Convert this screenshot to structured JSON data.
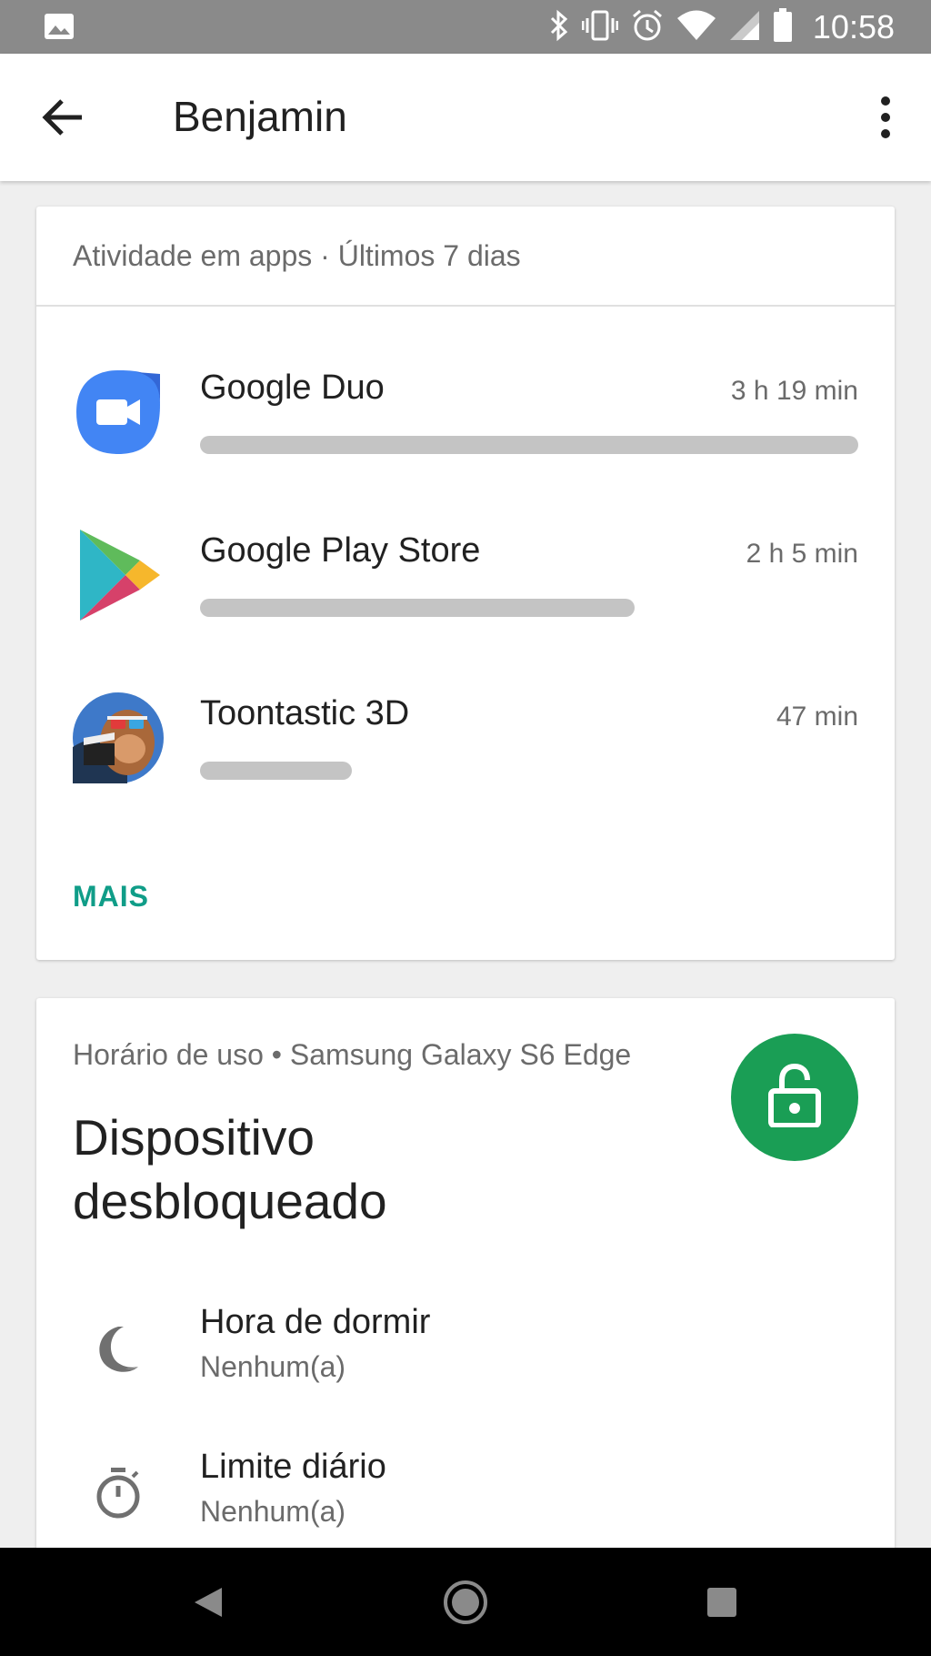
{
  "status_bar": {
    "time": "10:58",
    "icons": [
      "image-icon",
      "bluetooth-icon",
      "vibrate-icon",
      "alarm-icon",
      "wifi-icon",
      "signal-icon",
      "battery-icon"
    ]
  },
  "app_bar": {
    "title": "Benjamin",
    "icons": [
      "back-arrow-icon",
      "more-vert-icon"
    ]
  },
  "activity_card": {
    "header": "Atividade em apps · Últimos 7 dias",
    "apps": [
      {
        "name": "Google Duo",
        "time": "3 h 19 min",
        "usage_fraction": 1.0,
        "icon": "google-duo-icon",
        "color": "#4285f4"
      },
      {
        "name": "Google Play Store",
        "time": "2 h 5 min",
        "usage_fraction": 0.66,
        "icon": "play-store-icon"
      },
      {
        "name": "Toontastic 3D",
        "time": "47 min",
        "usage_fraction": 0.23,
        "icon": "toontastic-icon"
      }
    ],
    "more_label": "MAIS"
  },
  "device_card": {
    "subtitle": "Horário de uso • Samsung Galaxy S6 Edge",
    "heading": "Dispositivo desbloqueado",
    "lock_icon": "unlocked-lock-icon",
    "lock_color": "#1a9e55",
    "settings": [
      {
        "title": "Hora de dormir",
        "value": "Nenhum(a)",
        "icon": "moon-icon"
      },
      {
        "title": "Limite diário",
        "value": "Nenhum(a)",
        "icon": "timer-icon"
      }
    ]
  },
  "nav_bar": {
    "icons": [
      "back-triangle-icon",
      "home-circle-icon",
      "recents-square-icon"
    ]
  },
  "colors": {
    "accent": "#109d88",
    "bar_fill": "#c4c4c4",
    "status_bar": "#8a8a8a"
  }
}
